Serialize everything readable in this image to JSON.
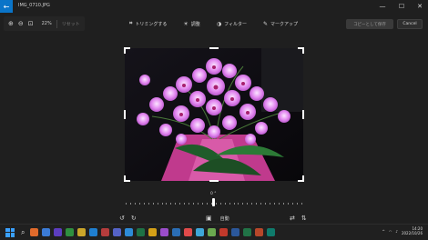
{
  "window": {
    "file_title": "IMG_0710.JPG",
    "back_icon": "back-arrow-icon",
    "minimize": "—",
    "maximize": "☐",
    "close": "✕"
  },
  "zoom": {
    "zoom_in_icon": "⊕",
    "zoom_out_icon": "⊖",
    "fit_icon": "⊡",
    "percent": "22%",
    "reset_label": "リセット"
  },
  "tabs": [
    {
      "label": "トリミングする",
      "icon": "⌗",
      "active": true
    },
    {
      "label": "調整",
      "icon": "☀"
    },
    {
      "label": "フィルター",
      "icon": "◑"
    },
    {
      "label": "マークアップ",
      "icon": "✎"
    }
  ],
  "actions": {
    "save_copy": "コピーとして保存",
    "cancel": "Cancel"
  },
  "rotation": {
    "angle": "0 °",
    "rotate_left_icon": "↺",
    "rotate_right_icon": "↻",
    "auto_icon": "▣",
    "auto_label": "自動",
    "flip_h_icon": "⇄",
    "flip_v_icon": "⇅"
  },
  "taskbar": {
    "time": "14:20",
    "date": "2022/10/26",
    "apps": [
      "#e06a2b",
      "#3b7bd6",
      "#5c3dbf",
      "#2f8f3f",
      "#caa52a",
      "#1f7fd0",
      "#b43c3c",
      "#5563c7",
      "#2d8bd8",
      "#1e7145",
      "#d4a017",
      "#9b4dca",
      "#2a6db5",
      "#e04a4a",
      "#3ea6d8",
      "#6aa84f",
      "#c1392b",
      "#2b579a",
      "#217346",
      "#b7472a",
      "#0f7b6c"
    ]
  }
}
